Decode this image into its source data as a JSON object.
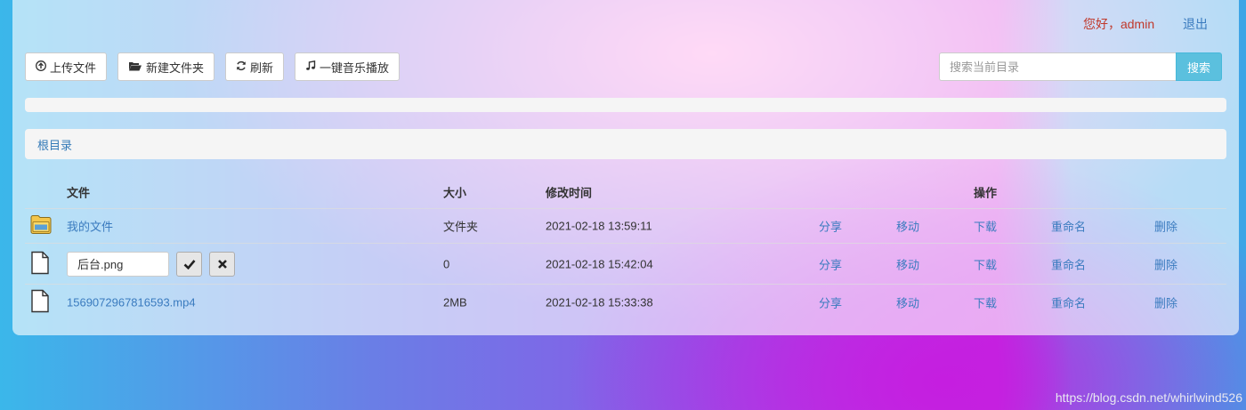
{
  "user": {
    "greeting": "您好，admin",
    "logout": "退出"
  },
  "toolbar": {
    "upload": "上传文件",
    "new_folder": "新建文件夹",
    "refresh": "刷新",
    "play_music": "一键音乐播放"
  },
  "search": {
    "placeholder": "搜索当前目录",
    "button": "搜索"
  },
  "breadcrumb": {
    "root": "根目录"
  },
  "table": {
    "headers": {
      "name": "文件",
      "size": "大小",
      "modified": "修改时间",
      "actions": "操作"
    },
    "rows": [
      {
        "name": "我的文件",
        "size": "文件夹",
        "modified": "2021-02-18 13:59:11",
        "icon": "folder-icon"
      },
      {
        "name": "后台.png",
        "size": "0",
        "modified": "2021-02-18 15:42:04",
        "icon": "file-icon",
        "editing": true
      },
      {
        "name": "1569072967816593.mp4",
        "size": "2MB",
        "modified": "2021-02-18 15:33:38",
        "icon": "file-icon"
      }
    ],
    "ops": {
      "share": "分享",
      "move": "移动",
      "download": "下载",
      "rename": "重命名",
      "delete": "删除"
    }
  },
  "watermark": "https://blog.csdn.net/whirlwind526"
}
